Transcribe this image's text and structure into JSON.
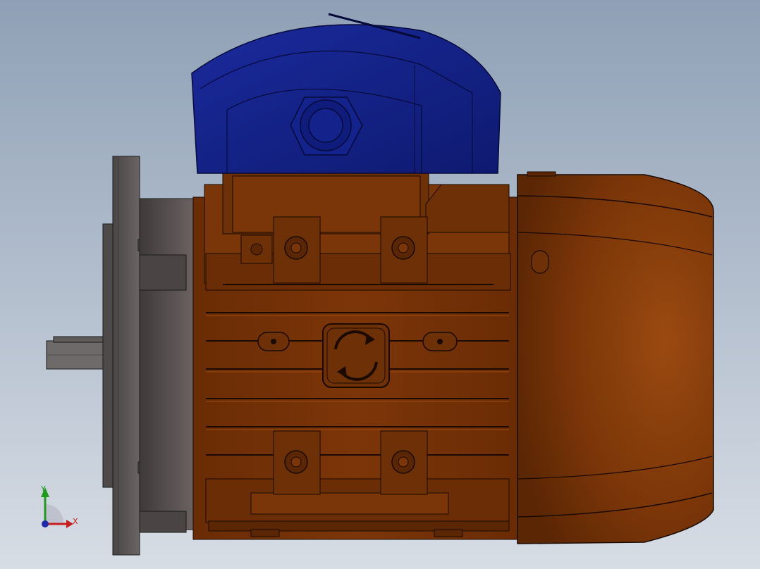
{
  "viewport": {
    "background_top": "#8fa0b6",
    "background_bottom": "#d7dde5"
  },
  "model": {
    "body_color": "#7a3508",
    "body_dark": "#4a1f04",
    "terminal_box_color": "#14228c",
    "flange_color": "#5a5656",
    "shaft_color": "#6e6a6a",
    "edge_color": "#1a0a00"
  },
  "triad": {
    "x_label": "X",
    "y_label": "Y",
    "x_color": "#c81e1e",
    "y_color": "#1e9a1e",
    "z_color": "#1e2aa8"
  }
}
